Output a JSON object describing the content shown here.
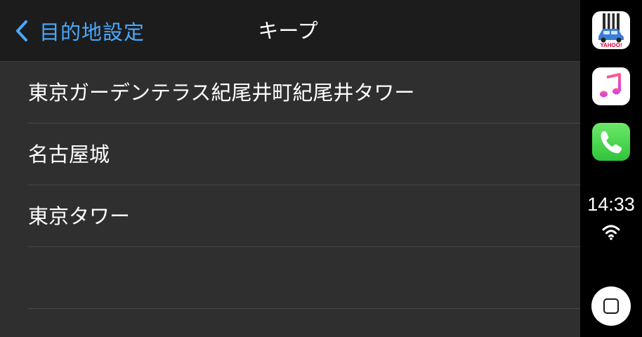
{
  "navbar": {
    "back_label": "目的地設定",
    "title": "キープ"
  },
  "list": {
    "items": [
      {
        "label": "東京ガーデンテラス紀尾井町紀尾井タワー"
      },
      {
        "label": "名古屋城"
      },
      {
        "label": "東京タワー"
      },
      {
        "label": ""
      }
    ]
  },
  "dock": {
    "apps": [
      {
        "icon": "yahoo-car-navi-icon",
        "brand_text": "YAHOO!"
      },
      {
        "icon": "music-icon"
      },
      {
        "icon": "phone-icon"
      }
    ],
    "time": "14:33",
    "status_icon": "wifi-icon",
    "home_icon": "home-button-icon"
  },
  "colors": {
    "accent": "#4aa8ff",
    "navbar_bg": "#1c1c1c",
    "list_bg": "#2f2f2f",
    "dock_bg": "#000000",
    "separator": "#474747"
  }
}
